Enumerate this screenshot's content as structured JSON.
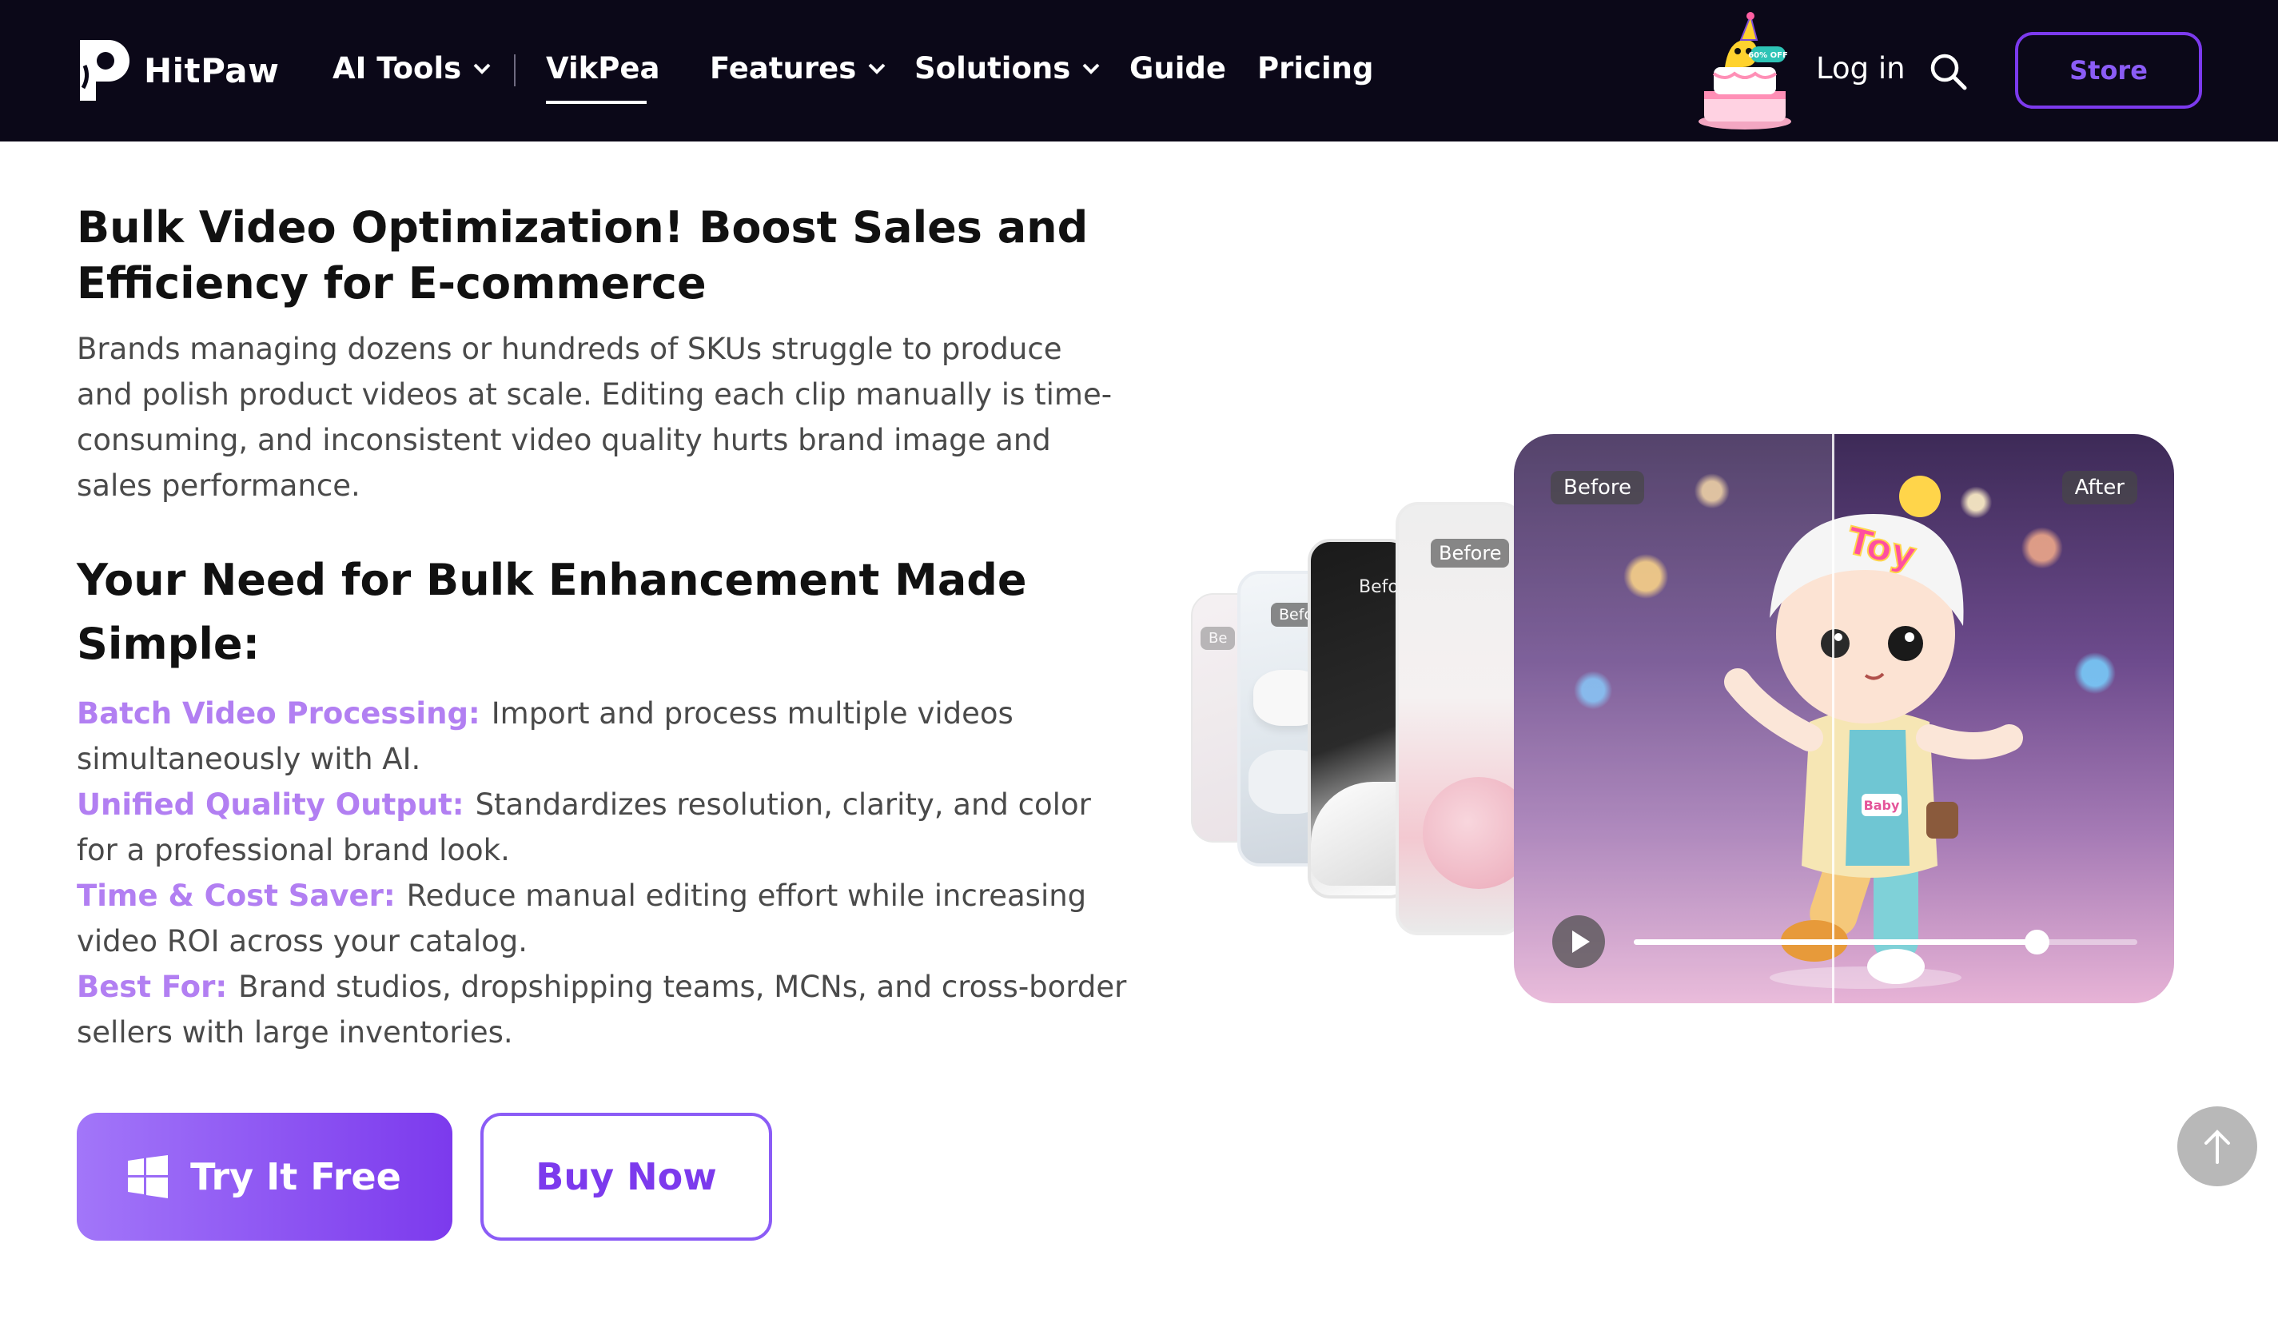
{
  "nav": {
    "logo_text": "HitPaw",
    "items": [
      {
        "label": "AI Tools",
        "has_dropdown": true
      },
      {
        "label": "VikPea",
        "has_dropdown": false,
        "active": true
      },
      {
        "label": "Features",
        "has_dropdown": true
      },
      {
        "label": "Solutions",
        "has_dropdown": true
      },
      {
        "label": "Guide",
        "has_dropdown": false
      },
      {
        "label": "Pricing",
        "has_dropdown": false
      }
    ],
    "login_label": "Log in",
    "store_label": "Store",
    "promo_badge_text": "60% OFF",
    "accent_color": "#7c3aed"
  },
  "section": {
    "title": "Bulk Video Optimization! Boost Sales and Efficiency for E-commerce",
    "intro": "Brands managing dozens or hundreds of SKUs struggle to produce and polish product videos at scale. Editing each clip manually is time-consuming, and inconsistent video quality hurts brand image and sales performance.",
    "subtitle": "Your Need for Bulk Enhancement Made Simple:",
    "features": [
      {
        "label": "Batch Video Processing:",
        "text": "Import and process multiple videos simultaneously with AI."
      },
      {
        "label": "Unified Quality Output:",
        "text": "Standardizes resolution, clarity, and color for a professional brand look."
      },
      {
        "label": "Time & Cost Saver:",
        "text": "Reduce manual editing effort while increasing video ROI across your catalog."
      },
      {
        "label": "Best For:",
        "text": "Brand studios, dropshipping teams, MCNs, and cross-border sellers with large inventories."
      }
    ],
    "feature_label_color": "#b27ff2",
    "try_button_label": "Try It Free",
    "buy_button_label": "Buy Now"
  },
  "preview": {
    "before_label": "Before",
    "after_label": "After",
    "toy_text": "Toy",
    "shirt_text": "Baby",
    "stack_labels": [
      "Be",
      "Befo",
      "Befor",
      "Before"
    ],
    "progress": 0.8
  },
  "icons": {
    "logo": "hitpaw-logo-icon",
    "dropdown": "chevron-down-icon",
    "search": "search-icon",
    "windows": "windows-icon",
    "play": "play-icon",
    "to_top": "arrow-up-icon",
    "promo": "birthday-cake-icon"
  }
}
